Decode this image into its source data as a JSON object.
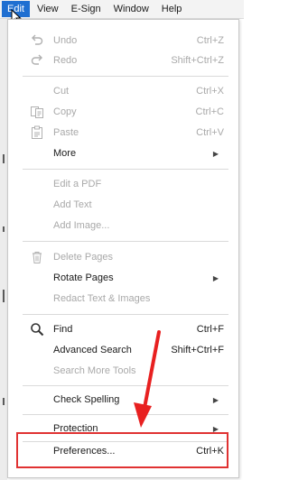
{
  "menubar": {
    "items": [
      {
        "label": "Edit"
      },
      {
        "label": "View"
      },
      {
        "label": "E-Sign"
      },
      {
        "label": "Window"
      },
      {
        "label": "Help"
      }
    ]
  },
  "menu": {
    "undo": {
      "label": "Undo",
      "shortcut": "Ctrl+Z"
    },
    "redo": {
      "label": "Redo",
      "shortcut": "Shift+Ctrl+Z"
    },
    "cut": {
      "label": "Cut",
      "shortcut": "Ctrl+X"
    },
    "copy": {
      "label": "Copy",
      "shortcut": "Ctrl+C"
    },
    "paste": {
      "label": "Paste",
      "shortcut": "Ctrl+V"
    },
    "more": {
      "label": "More"
    },
    "edit_pdf": {
      "label": "Edit a PDF"
    },
    "add_text": {
      "label": "Add Text"
    },
    "add_image": {
      "label": "Add Image..."
    },
    "delete_pages": {
      "label": "Delete Pages"
    },
    "rotate_pages": {
      "label": "Rotate Pages"
    },
    "redact": {
      "label": "Redact Text & Images"
    },
    "find": {
      "label": "Find",
      "shortcut": "Ctrl+F"
    },
    "adv_search": {
      "label": "Advanced Search",
      "shortcut": "Shift+Ctrl+F"
    },
    "search_more": {
      "label": "Search More Tools"
    },
    "check_spelling": {
      "label": "Check Spelling"
    },
    "protection": {
      "label": "Protection"
    },
    "preferences": {
      "label": "Preferences...",
      "shortcut": "Ctrl+K"
    }
  },
  "colors": {
    "active_menu": "#1f6fd1",
    "highlight": "#e03232",
    "disabled_text": "#a9a9a9"
  },
  "icons": {
    "undo": "undo-icon",
    "redo": "redo-icon",
    "copy": "copy-icon",
    "paste": "paste-icon",
    "delete": "trash-icon",
    "find": "search-icon",
    "submenu": "chevron-right-icon"
  }
}
